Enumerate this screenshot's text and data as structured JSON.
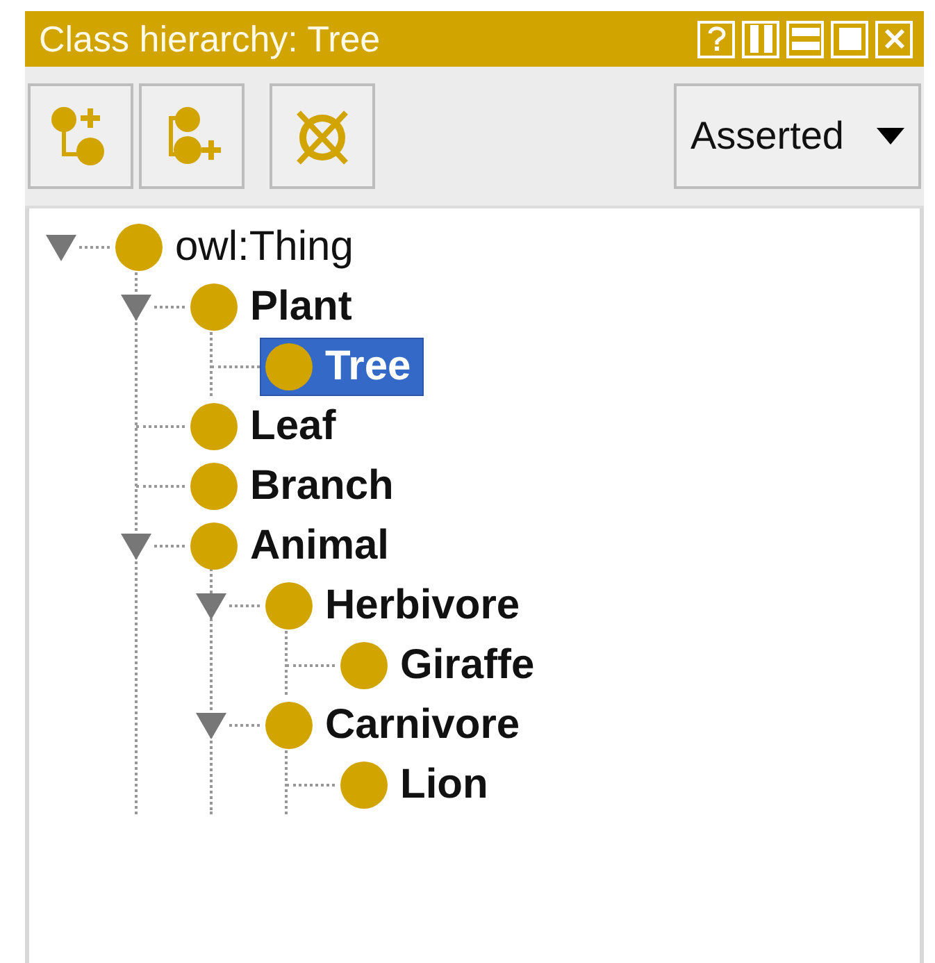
{
  "window": {
    "title": "Class hierarchy: Tree"
  },
  "toolbar": {
    "dropdown": {
      "value": "Asserted"
    }
  },
  "tree": [
    {
      "label": "owl:Thing",
      "bold": false,
      "selected": false,
      "expanded": true,
      "children": [
        {
          "label": "Plant",
          "bold": true,
          "selected": false,
          "expanded": true,
          "children": [
            {
              "label": "Tree",
              "bold": true,
              "selected": true
            }
          ]
        },
        {
          "label": "Leaf",
          "bold": true,
          "selected": false
        },
        {
          "label": "Branch",
          "bold": true,
          "selected": false
        },
        {
          "label": "Animal",
          "bold": true,
          "selected": false,
          "expanded": true,
          "children": [
            {
              "label": "Herbivore",
              "bold": true,
              "selected": false,
              "expanded": true,
              "children": [
                {
                  "label": "Giraffe",
                  "bold": true,
                  "selected": false
                }
              ]
            },
            {
              "label": "Carnivore",
              "bold": true,
              "selected": false,
              "expanded": true,
              "children": [
                {
                  "label": "Lion",
                  "bold": true,
                  "selected": false
                }
              ]
            }
          ]
        }
      ]
    }
  ]
}
